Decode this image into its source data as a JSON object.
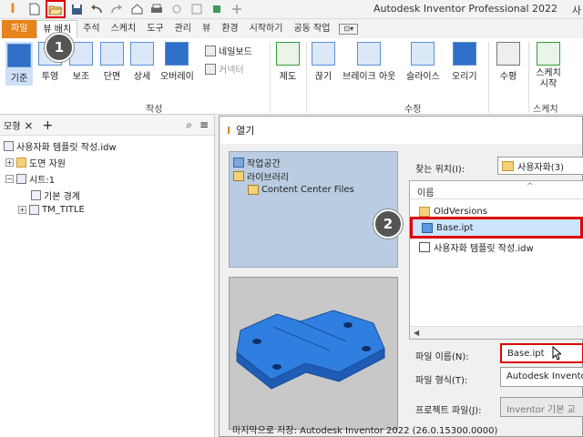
{
  "app": {
    "title": "Autodesk Inventor Professional 2022",
    "title_right_cut": "사",
    "logo": "I"
  },
  "quick_access": [
    {
      "icon": "new-file-icon",
      "glyph": "🗋"
    },
    {
      "icon": "open-folder-icon",
      "glyph": "📂"
    },
    {
      "icon": "save-icon",
      "glyph": "💾"
    },
    {
      "icon": "undo-icon",
      "glyph": "↶"
    },
    {
      "icon": "redo-icon",
      "glyph": "↷"
    },
    {
      "icon": "home-icon",
      "glyph": "⌂"
    },
    {
      "icon": "print-icon",
      "glyph": "🖶"
    },
    {
      "icon": "update-icon",
      "glyph": "⚡"
    },
    {
      "icon": "measure-icon",
      "glyph": "⊞"
    },
    {
      "icon": "add-icon",
      "glyph": "+"
    }
  ],
  "tabs": [
    "파일",
    "뷰 배치",
    "주석",
    "스케치",
    "도구",
    "관리",
    "뷰",
    "환경",
    "시작하기",
    "공동 작업",
    "⊡▾"
  ],
  "ribbon": {
    "create_buttons": [
      {
        "label": "기준"
      },
      {
        "label": "투영"
      },
      {
        "label": "보조"
      },
      {
        "label": "단면"
      },
      {
        "label": "상세"
      },
      {
        "label": "오버레이"
      }
    ],
    "small_buttons": [
      {
        "label": "네일보드"
      },
      {
        "label": "커넥터"
      }
    ],
    "create_group": "작성",
    "modify_buttons": [
      {
        "label": "제도"
      },
      {
        "label": "끊기"
      },
      {
        "label": "브레이크 아웃"
      },
      {
        "label": "슬라이스"
      },
      {
        "label": "오리기"
      },
      {
        "label": "수평"
      },
      {
        "label": "스케치 시작"
      }
    ],
    "modify_group": "수정",
    "sketch_group": "스케치"
  },
  "markers": {
    "step1": "1",
    "step2": "2"
  },
  "browser": {
    "tab_label": "모형",
    "close": "×",
    "add": "+",
    "items": [
      {
        "label": "사용자화 템플릿 작성.idw"
      },
      {
        "label": "도면 자원"
      },
      {
        "label": "시트:1"
      },
      {
        "label": "기본 경계"
      },
      {
        "label": "TM_TITLE"
      }
    ]
  },
  "dialog": {
    "title": "열기",
    "places": [
      {
        "label": "작업공간"
      },
      {
        "label": "라이브러리"
      },
      {
        "label": "Content Center Files"
      }
    ],
    "look_in_label": "찾는 위치(I):",
    "look_in_value": "사용자화(3)",
    "column_name": "이름",
    "files": [
      {
        "name": "OldVersions",
        "type": "folder"
      },
      {
        "name": "Base.ipt",
        "type": "part"
      },
      {
        "name": "사용자화 템플릿 작성.idw",
        "type": "idw"
      }
    ],
    "file_name_label": "파일 이름(N):",
    "file_name_value": "Base.ipt",
    "file_type_label": "파일 형식(T):",
    "file_type_value": "Autodesk Inventor",
    "project_label": "프로젝트 파일(J):",
    "project_value": "Inventor 기본 교",
    "last_saved": "마지막으로 저장: Autodesk Inventor 2022 (26.0.15300.0000)"
  },
  "colors": {
    "accent_orange": "#e8821a",
    "highlight_red": "#dd0000",
    "selection_blue": "#cce4fb",
    "part_blue": "#2f7fe0"
  }
}
